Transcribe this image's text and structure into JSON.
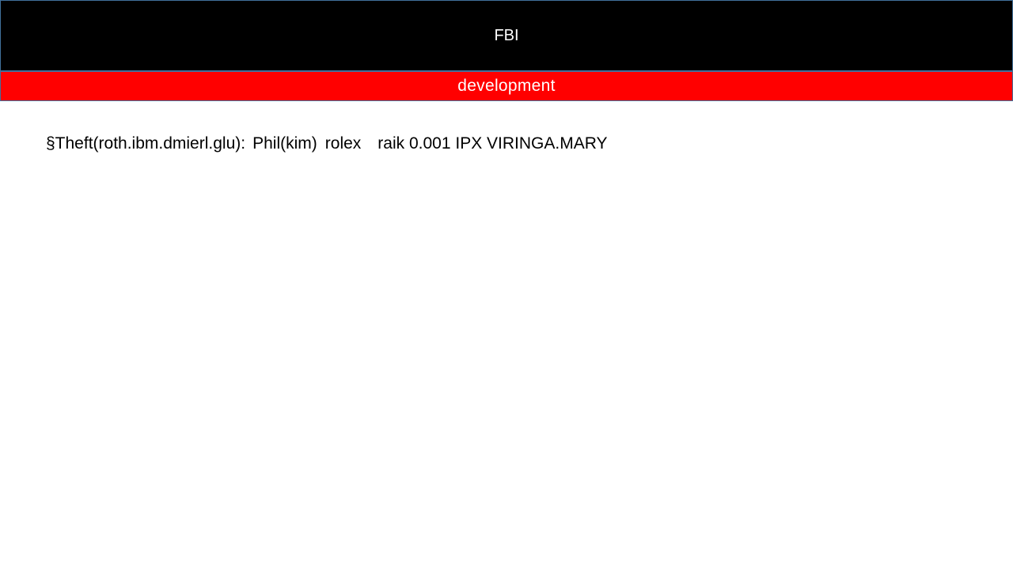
{
  "header": {
    "title": "FBI",
    "background": "#000000",
    "text_color": "#ffffff"
  },
  "subheader": {
    "title": "development",
    "background": "#ff0000",
    "text_color": "#ffffff"
  },
  "body": {
    "segments": [
      "§Theft(roth.ibm.dmierl.glu):",
      "Phil(kim)",
      "rolex",
      "raik 0.001 IPX VIRINGA.MARY"
    ]
  }
}
